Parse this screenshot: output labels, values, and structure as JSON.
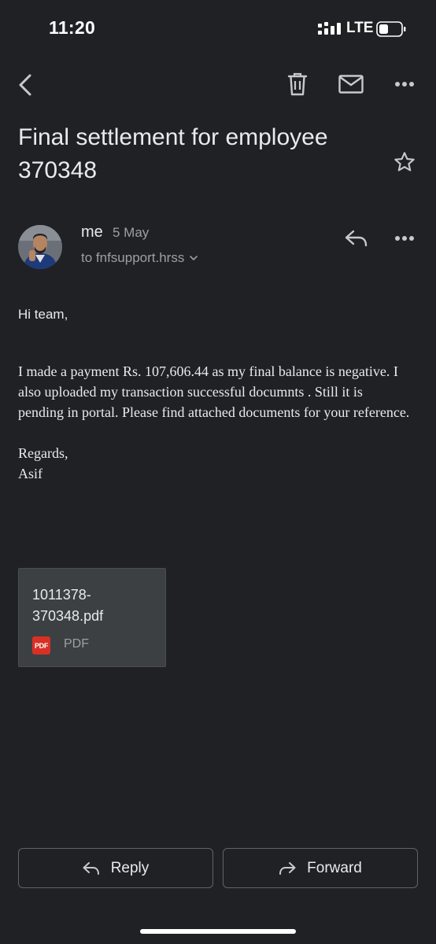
{
  "status_bar": {
    "time": "11:20",
    "network": "LTE"
  },
  "toolbar": {
    "back_icon": "back-arrow-icon",
    "delete_icon": "trash-icon",
    "unread_icon": "mail-icon",
    "more_icon": "more-vert-icon"
  },
  "subject": "Final settlement for employee 370348",
  "sender": {
    "name": "me",
    "date": "5 May",
    "recipient": "to fnfsupport.hrss"
  },
  "body": {
    "greeting": "Hi team,",
    "paragraph": "I made a payment Rs. 107,606.44 as my final balance is negative. I also uploaded my transaction successful documnts . Still it is pending in portal. Please find attached documents for your reference.",
    "closing": "Regards,",
    "signature": "Asif"
  },
  "attachment": {
    "filename": "1011378-370348.pdf",
    "badge": "PDF",
    "type": "PDF"
  },
  "actions": {
    "reply": "Reply",
    "forward": "Forward"
  },
  "colors": {
    "background": "#202124",
    "text": "#e8eaed",
    "muted": "#9aa0a6",
    "pdf_badge": "#d93025",
    "border": "#5f6368"
  }
}
